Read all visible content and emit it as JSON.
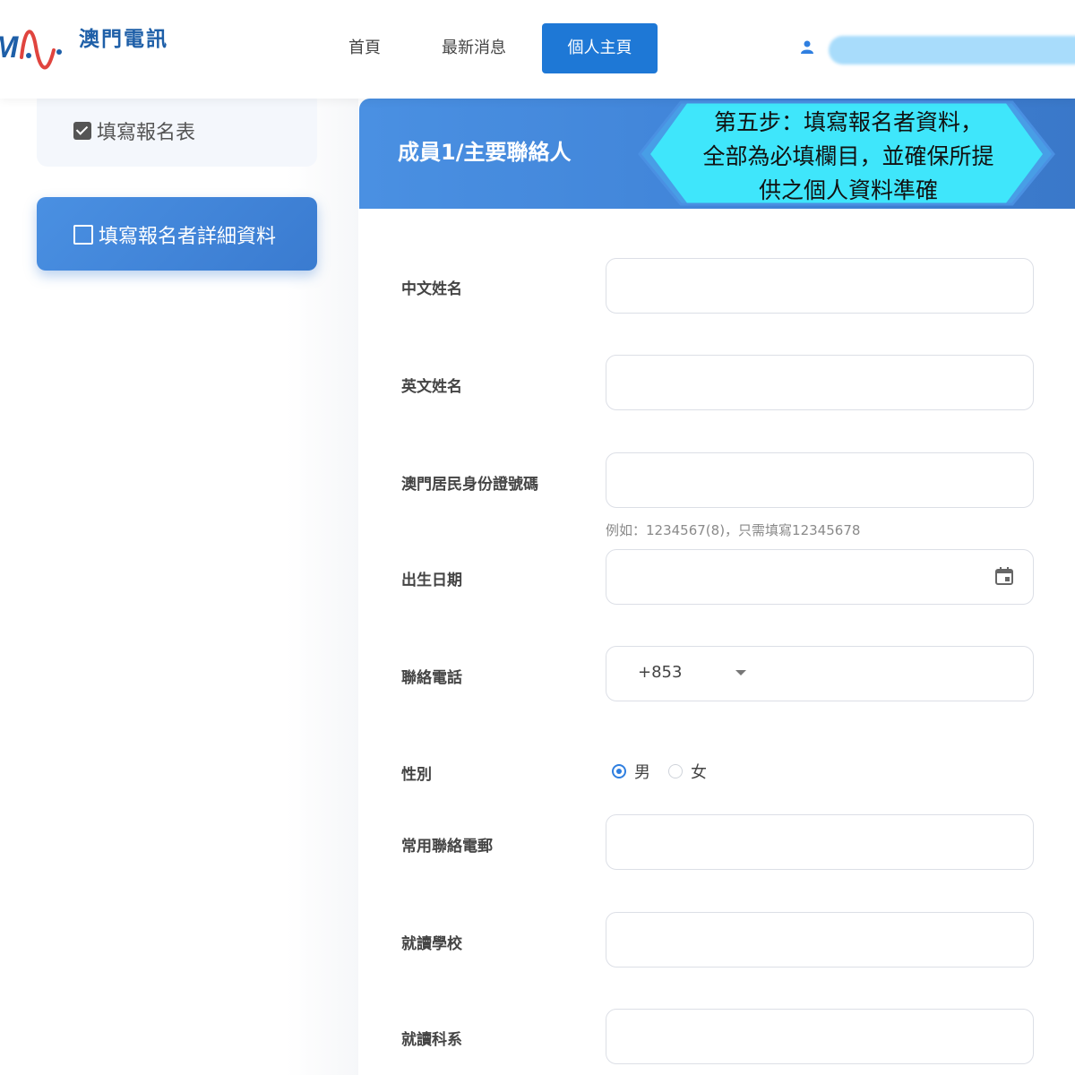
{
  "header": {
    "logo_letters": "M",
    "brand_name": "澳門電訊",
    "nav": {
      "home": "首頁",
      "news": "最新消息",
      "personal": "個人主頁"
    },
    "user_icon": "person-icon"
  },
  "sidebar": {
    "steps": [
      {
        "label": "填寫報名表",
        "checked": true
      },
      {
        "label": "填寫報名者詳細資料",
        "checked": false
      }
    ]
  },
  "panel": {
    "title": "成員1/主要聯絡人",
    "banner_lines": [
      "第五步：填寫報名者資料，",
      "全部為必填欄目，並確保所提",
      "供之個人資料準確"
    ]
  },
  "form": {
    "chinese_name": {
      "label": "中文姓名",
      "value": ""
    },
    "english_name": {
      "label": "英文姓名",
      "value": ""
    },
    "id_number": {
      "label": "澳門居民身份證號碼",
      "value": "",
      "hint": "例如：1234567(8)，只需填寫12345678"
    },
    "birth_date": {
      "label": "出生日期",
      "value": "",
      "icon": "calendar-icon"
    },
    "phone": {
      "label": "聯絡電話",
      "country_code": "+853",
      "value": ""
    },
    "gender": {
      "label": "性別",
      "options": [
        "男",
        "女"
      ],
      "selected": "男"
    },
    "email": {
      "label": "常用聯絡電郵",
      "value": ""
    },
    "school": {
      "label": "就讀學校",
      "value": ""
    },
    "department": {
      "label": "就讀科系",
      "value": ""
    }
  },
  "colors": {
    "primary": "#1e78d6",
    "panel_header": "#4a90e2",
    "banner_fill": "#3fe6fb",
    "banner_stroke": "#4a90e2"
  }
}
